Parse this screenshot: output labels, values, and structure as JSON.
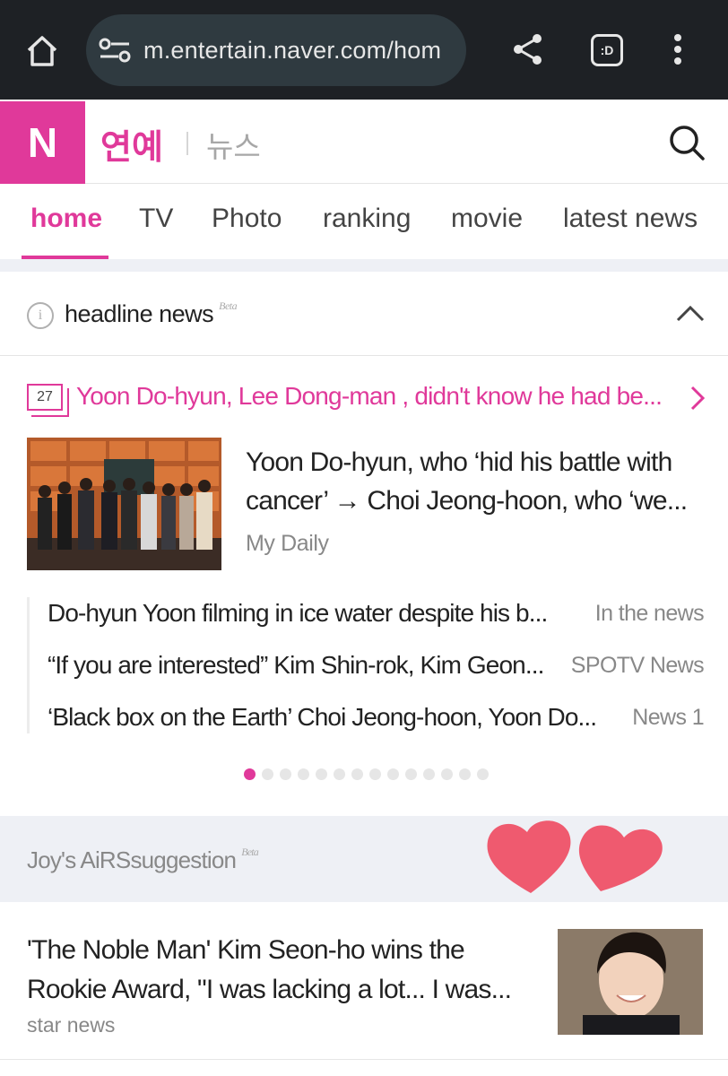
{
  "browser": {
    "url": "m.entertain.naver.com/hom",
    "tab_count_label": ":D",
    "icons": [
      "home-icon",
      "site-settings-icon",
      "share-icon",
      "tabs-icon",
      "more-vert-icon"
    ]
  },
  "header": {
    "logo": "N",
    "section_title": "연예",
    "section_sub": "뉴스"
  },
  "nav": {
    "tabs": [
      {
        "label": "home",
        "active": true
      },
      {
        "label": "TV",
        "active": false
      },
      {
        "label": "Photo",
        "active": false
      },
      {
        "label": "ranking",
        "active": false
      },
      {
        "label": "movie",
        "active": false
      },
      {
        "label": "latest news",
        "active": false
      }
    ]
  },
  "headline": {
    "label": "headline news",
    "beta": "Beta",
    "topic": {
      "count": "27",
      "title": "Yoon Do-hyun, Lee Dong-man , didn't know he had be..."
    },
    "main": {
      "title": "Yoon Do-hyun, who ‘hid his battle with cancer’ → Choi Jeong-hoon, who ‘we...",
      "source": "My Daily"
    },
    "related": [
      {
        "title": "Do-hyun Yoon filming in ice water despite his b...",
        "source": "In the news"
      },
      {
        "title": "“If you are interested” Kim Shin-rok, Kim Geon...",
        "source": "SPOTV News"
      },
      {
        "title": "‘Black box on the Earth’ Choi Jeong-hoon, Yoon Do...",
        "source": "News 1"
      }
    ],
    "pager": {
      "total": 14,
      "current": 1
    }
  },
  "airs": {
    "title": "Joy's AiRSsuggestion",
    "beta": "Beta",
    "article": {
      "title": "'The Noble Man' Kim Seon-ho wins the Rookie Award, \"I was lacking a lot... I was...",
      "source": "star news"
    }
  },
  "colors": {
    "brand": "#e0399a",
    "browser_bar": "#1e2125",
    "band": "#eef0f5",
    "heart": "#ef5a6f"
  }
}
